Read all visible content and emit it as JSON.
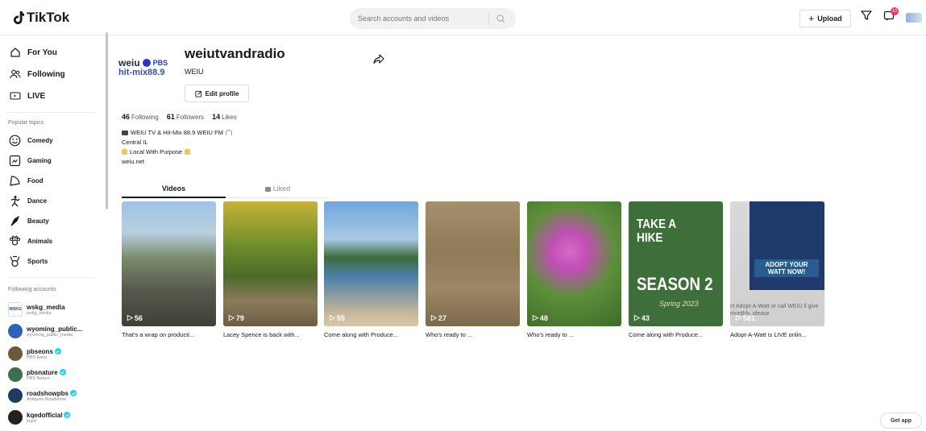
{
  "header": {
    "logo_text": "TikTok",
    "search_placeholder": "Search accounts and videos",
    "upload_label": "Upload",
    "notification_count": "10"
  },
  "sidebar": {
    "nav": [
      {
        "label": "For You",
        "icon": "home-icon"
      },
      {
        "label": "Following",
        "icon": "following-icon"
      },
      {
        "label": "LIVE",
        "icon": "live-icon"
      }
    ],
    "popular_title": "Popular topics",
    "topics": [
      {
        "label": "Comedy",
        "icon": "comedy-icon"
      },
      {
        "label": "Gaming",
        "icon": "gaming-icon"
      },
      {
        "label": "Food",
        "icon": "food-icon"
      },
      {
        "label": "Dance",
        "icon": "dance-icon"
      },
      {
        "label": "Beauty",
        "icon": "beauty-icon"
      },
      {
        "label": "Animals",
        "icon": "animals-icon"
      },
      {
        "label": "Sports",
        "icon": "sports-icon"
      }
    ],
    "following_title": "Following accounts",
    "accounts": [
      {
        "name": "wskg_media",
        "sub": "wskg_media",
        "verified": false,
        "color": "#1a4e8a"
      },
      {
        "name": "wyoming_public...",
        "sub": "wyoming_public_media",
        "verified": false,
        "color": "#2a63b8"
      },
      {
        "name": "pbseons",
        "sub": "PBS Eons",
        "verified": true,
        "color": "#6b5a3a"
      },
      {
        "name": "pbsnature",
        "sub": "PBS Nature",
        "verified": true,
        "color": "#3f6e4a"
      },
      {
        "name": "roadshowpbs",
        "sub": "Antiques Roadshow",
        "verified": true,
        "color": "#1d3b5e"
      },
      {
        "name": "kqedofficial",
        "sub": "kqed",
        "verified": true,
        "color": "#222222"
      }
    ]
  },
  "profile": {
    "username": "weiutvandradio",
    "display_name": "WEIU",
    "edit_label": "Edit profile",
    "avatar_text_top": "weiu",
    "avatar_text_pbs": "PBS",
    "avatar_text_bottom": "hit-mix88.9",
    "following_count": "46",
    "following_label": "Following",
    "followers_count": "61",
    "followers_label": "Followers",
    "likes_count": "14",
    "likes_label": "Likes",
    "bio": [
      "WEIU TV & Hit-Mix 88.9 WEIU FM",
      "Central IL",
      "Local With Purpose",
      "weiu.net"
    ]
  },
  "tabs": {
    "videos": "Videos",
    "liked": "Liked"
  },
  "videos": [
    {
      "views": "56",
      "caption": "That's a wrap on producti...",
      "bg": "linear-gradient(180deg,#9ec3e6 0%,#b9cfe0 25%,#7c8c6e 45%,#585a4e 70%,#3f4036 100%)"
    },
    {
      "views": "79",
      "caption": "Lacey Spence is back with...",
      "bg": "linear-gradient(180deg,#c7b23a 0%,#6f8f2a 35%,#4d6a2a 60%,#8c7a5c 80%,#6b5c44 100%)"
    },
    {
      "views": "55",
      "caption": "Come along with Produce...",
      "bg": "linear-gradient(180deg,#6fa6da 0%,#a9c9e6 30%,#3d6b3a 45%,#4a7fa8 60%,#c9b89a 90%,#d8c6a6 100%)"
    },
    {
      "views": "27",
      "caption": "Who's ready to ...",
      "bg": "linear-gradient(180deg,#a58f6c 0%,#8f7a58 40%,#9c8766 70%,#7d6a4d 100%)"
    },
    {
      "views": "48",
      "caption": "Who's ready to ...",
      "bg": "radial-gradient(circle at 45% 40%,#d86ac9 0%,#c14fb6 20%,#5d8f3a 50%,#3b6b2a 100%)"
    },
    {
      "views": "43",
      "caption": "Come along with Produce...",
      "bg": "#3e6f3b",
      "overlay_title": "TAKE A HIKE",
      "overlay_sub": "SEASON 2",
      "overlay_year": "Spring 2023"
    },
    {
      "views": "581",
      "caption": "Adopt-A-Watt is LIVE onlin...",
      "bg": "linear-gradient(180deg,#d9d9d9 0%,#cfcfcf 100%)",
      "overlay_title": "ADOPT YOUR WATT NOW!",
      "overlay_sub": "ct Adopt-A-Watt or call WEIU ll give monthly, please"
    }
  ],
  "get_app": "Get app",
  "colors": {
    "accent": "#fe2c55",
    "verified": "#20d5ec"
  }
}
